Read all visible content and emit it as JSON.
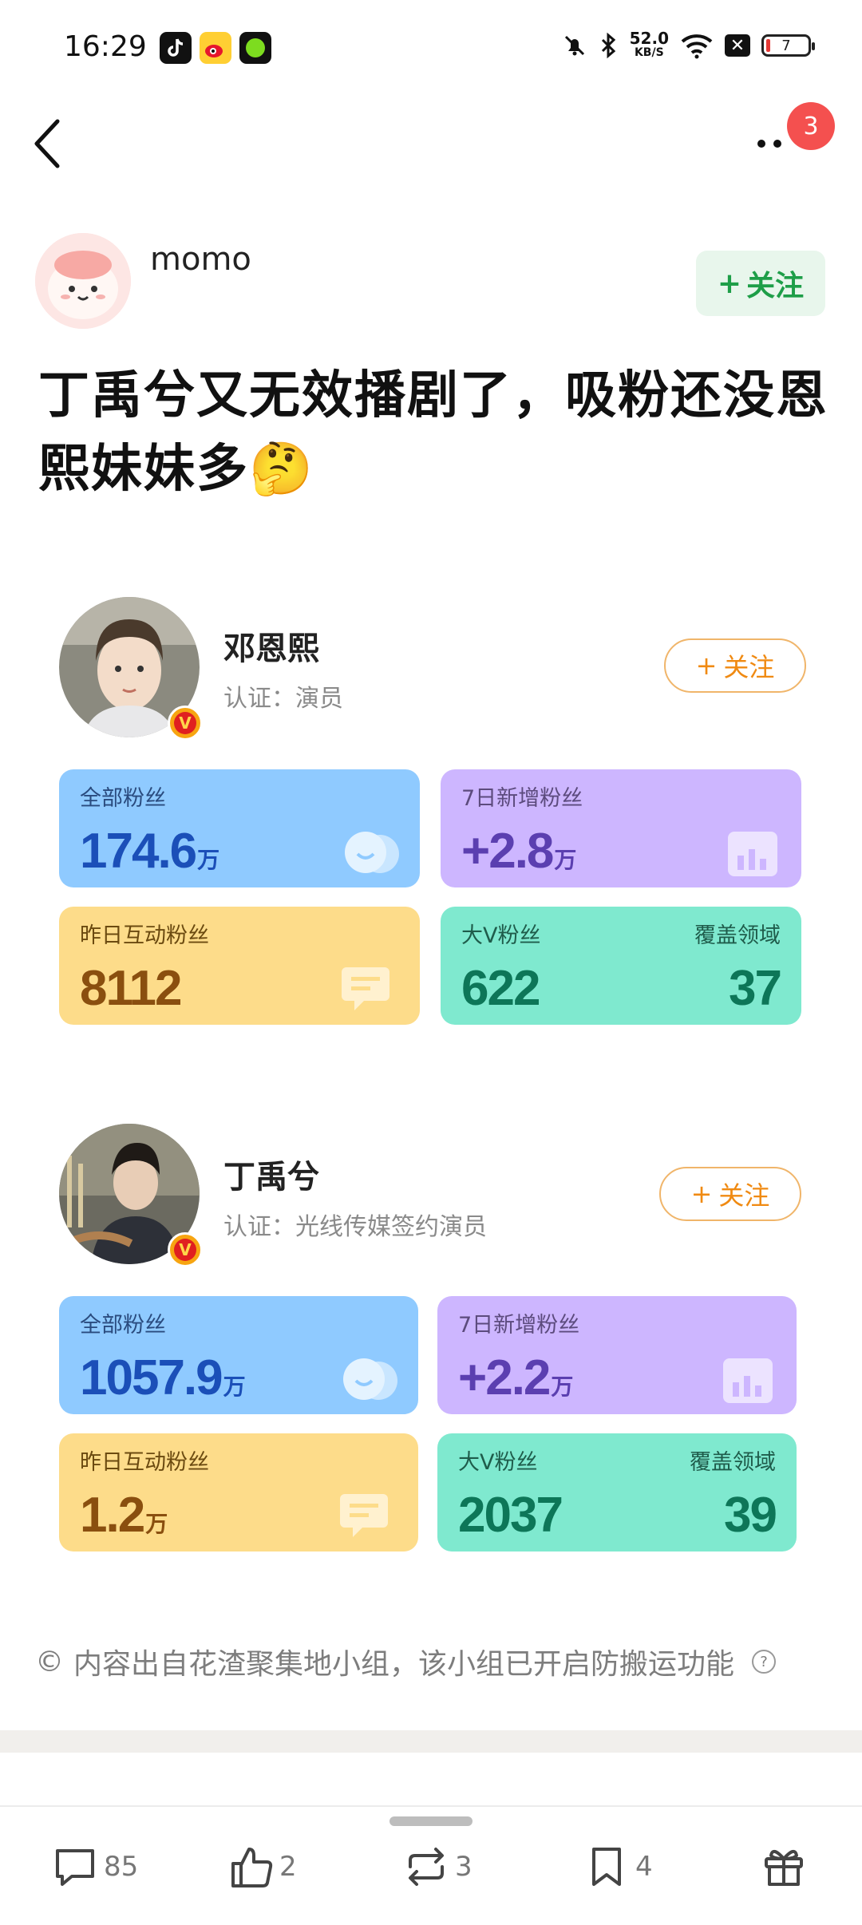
{
  "status_bar": {
    "time": "16:29",
    "net_speed_value": "52.0",
    "net_speed_unit": "KB/S",
    "battery_level": "7",
    "icons_left": [
      "tiktok-icon",
      "weibo-icon",
      "green-app-icon"
    ],
    "icons_right": [
      "mute-icon",
      "bluetooth-icon",
      "wifi-icon",
      "close-box-icon",
      "battery-icon"
    ]
  },
  "nav": {
    "badge_count": "3"
  },
  "author": {
    "name": "momo",
    "follow_label": "关注"
  },
  "post": {
    "title": "丁禹兮又无效播剧了，吸粉还没恩熙妹妹多🤔"
  },
  "profiles": [
    {
      "name": "邓恩熙",
      "certification": "认证：演员",
      "follow_label": "关注",
      "stats": {
        "all_fans_label": "全部粉丝",
        "all_fans_value": "174.6",
        "all_fans_unit": "万",
        "new_fans_label": "7日新增粉丝",
        "new_fans_value": "+2.8",
        "new_fans_unit": "万",
        "interact_label": "昨日互动粉丝",
        "interact_value": "8112",
        "interact_unit": "",
        "bigv_label": "大V粉丝",
        "bigv_value": "622",
        "coverage_label": "覆盖领域",
        "coverage_value": "37"
      }
    },
    {
      "name": "丁禹兮",
      "certification": "认证：光线传媒签约演员",
      "follow_label": "关注",
      "stats": {
        "all_fans_label": "全部粉丝",
        "all_fans_value": "1057.9",
        "all_fans_unit": "万",
        "new_fans_label": "7日新增粉丝",
        "new_fans_value": "+2.2",
        "new_fans_unit": "万",
        "interact_label": "昨日互动粉丝",
        "interact_value": "1.2",
        "interact_unit": "万",
        "bigv_label": "大V粉丝",
        "bigv_value": "2037",
        "coverage_label": "覆盖领域",
        "coverage_value": "39"
      }
    }
  ],
  "notice": {
    "text": "内容出自花渣聚集地小组，该小组已开启防搬运功能"
  },
  "bottom_bar": {
    "comments": "85",
    "likes": "2",
    "reposts": "3",
    "favorites": "4"
  },
  "colors": {
    "accent_green": "#1e9e48",
    "badge_red": "#f4504f",
    "follow_orange": "#f08a12",
    "card_blue": "#8fcaff",
    "card_purple": "#cdb6ff",
    "card_yellow": "#fddc8a",
    "card_green": "#7fe9cf"
  }
}
